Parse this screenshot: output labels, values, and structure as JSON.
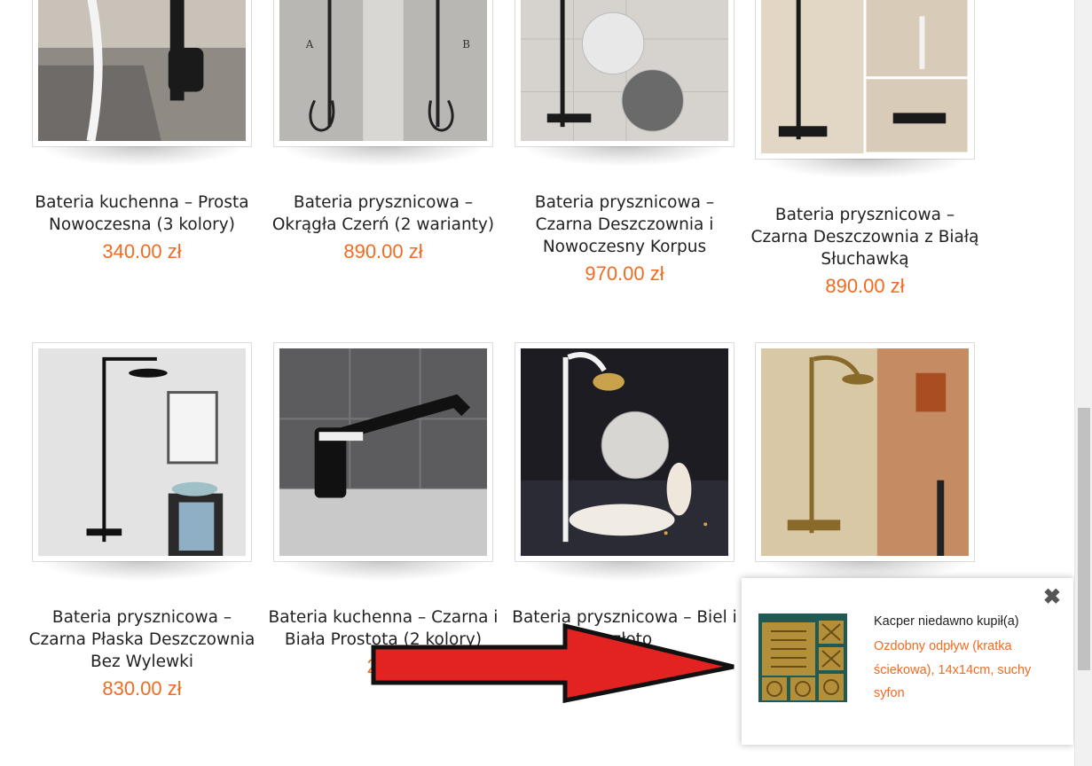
{
  "products": [
    {
      "title": "Bateria kuchenna – Prosta Nowoczesna (3 kolory)",
      "price": "340.00 zł"
    },
    {
      "title": "Bateria prysznicowa – Okrągła Czerń (2 warianty)",
      "price": "890.00 zł"
    },
    {
      "title": "Bateria prysznicowa – Czarna Deszczownia i Nowoczesny Korpus",
      "price": "970.00 zł"
    },
    {
      "title": "Bateria prysznicowa – Czarna Deszczownia z Białą Słuchawką",
      "price": "890.00 zł"
    },
    {
      "title": "Bateria prysznicowa – Czarna Płaska Deszczownia Bez Wylewki",
      "price": "830.00 zł"
    },
    {
      "title": "Bateria kuchenna – Czarna i Biała Prostota (2 kolory)",
      "price": "280"
    },
    {
      "title": "Bateria prysznicowa – Biel i ...złoto",
      "price": ""
    }
  ],
  "popup": {
    "buyer_text": "Kacper niedawno kupił(a)",
    "product_text": "Ozdobny odpływ (kratka ściekowa), 14x14cm, suchy syfon",
    "close_symbol": "✖"
  },
  "colors": {
    "price": "#f26b21",
    "arrow": "#e32222"
  }
}
